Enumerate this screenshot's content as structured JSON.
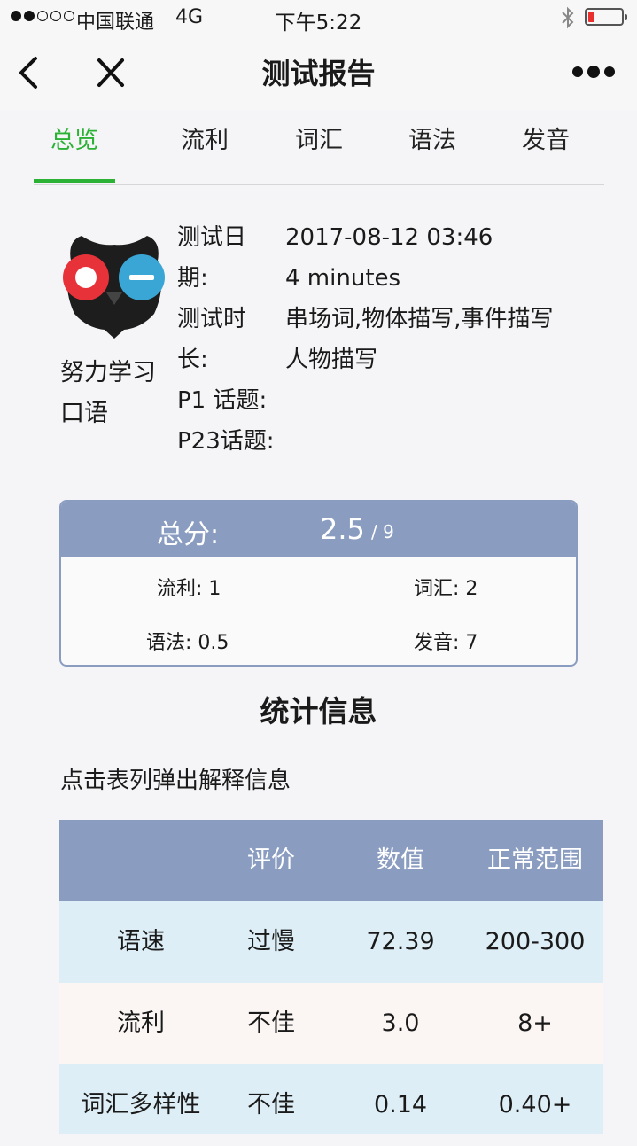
{
  "status_bar": {
    "carrier": "中国联通",
    "network": "4G",
    "time": "下午5:22",
    "signal_bars_filled": 2,
    "signal_bars_total": 5,
    "battery_level": 0.2
  },
  "nav": {
    "title": "测试报告"
  },
  "tabs": [
    {
      "label": "总览",
      "active": true
    },
    {
      "label": "流利",
      "active": false
    },
    {
      "label": "词汇",
      "active": false
    },
    {
      "label": "语法",
      "active": false
    },
    {
      "label": "发音",
      "active": false
    }
  ],
  "profile": {
    "username_line1": "努力学习",
    "username_line2": "口语",
    "labels": [
      "测试日",
      "期:",
      "测试时",
      "长:",
      "P1 话题:",
      "P23话题:"
    ],
    "values": [
      "2017-08-12 03:46",
      "4 minutes",
      "串场词,物体描写,事件描写",
      "人物描写"
    ]
  },
  "score": {
    "total_label": "总分:",
    "total_value": "2.5",
    "total_max": "/ 9",
    "fluency": "流利: 1",
    "vocabulary": "词汇: 2",
    "grammar": "语法: 0.5",
    "pronunciation": "发音: 7"
  },
  "stats": {
    "title": "统计信息",
    "hint": "点击表列弹出解释信息",
    "headers": [
      "",
      "评价",
      "数值",
      "正常范围"
    ],
    "rows": [
      [
        "语速",
        "过慢",
        "72.39",
        "200-300"
      ],
      [
        "流利",
        "不佳",
        "3.0",
        "8+"
      ],
      [
        "词汇多样性",
        "不佳",
        "0.14",
        "0.40+"
      ]
    ]
  },
  "colors": {
    "accent_green": "#2bb235",
    "table_header": "#8a9dc1",
    "row_blue": "#ddeef6",
    "row_warm": "#fbf6f3",
    "owl_red": "#e8323a",
    "owl_blue": "#3aa6d6"
  }
}
